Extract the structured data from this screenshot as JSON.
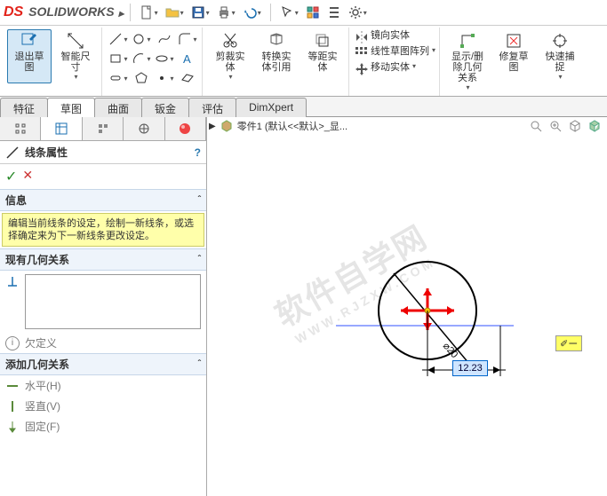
{
  "app": {
    "name": "SOLIDWORKS"
  },
  "ribbon": {
    "exit_sketch": "退出草\n图",
    "smart_dim": "智能尺\n寸",
    "trim": "剪裁实\n体",
    "convert": "转换实\n体引用",
    "offset": "等距实\n体",
    "mirror": "镜向实体",
    "linear_pattern": "线性草图阵列",
    "move": "移动实体",
    "show_rel": "显示/删\n除几何\n关系",
    "repair": "修复草\n图",
    "quick_snap": "快速捕\n捉"
  },
  "tabs": [
    "特征",
    "草图",
    "曲面",
    "钣金",
    "评估",
    "DimXpert"
  ],
  "active_tab": "草图",
  "crumb": "零件1  (默认<<默认>_显...",
  "panel": {
    "title": "线条属性",
    "info_hdr": "信息",
    "info_text": "编辑当前线条的设定，绘制一新线条，或选择确定来为下一新线条更改设定。",
    "existing": "现有几何关系",
    "lack_def": "欠定义",
    "add_rel": "添加几何关系",
    "horiz": "水平(H)",
    "vert": "竖直(V)",
    "fixed": "固定(F)"
  },
  "sketch": {
    "diameter_label": "⌀20",
    "dim_value": "12.23",
    "cursor_note": "✐ー"
  }
}
